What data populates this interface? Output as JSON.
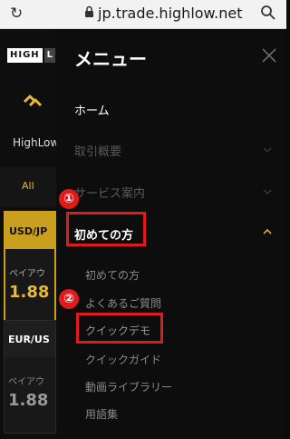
{
  "browser": {
    "url": "jp.trade.highlow.net"
  },
  "background": {
    "logo_white": "HIGH",
    "logo_dark": "L",
    "brand_text": "HighLow",
    "tab_all": "All",
    "card1": {
      "pair": "USD/JP",
      "label": "ペイアウ",
      "value": "1.88"
    },
    "card2": {
      "pair": "EUR/US",
      "label": "ペイアウ",
      "value": "1.88"
    }
  },
  "menu": {
    "title": "メニュー",
    "items": [
      {
        "label": "ホーム"
      },
      {
        "label": "取引概要"
      },
      {
        "label": "サービス案内"
      },
      {
        "label": "初めての方"
      }
    ],
    "subitems": [
      {
        "label": "初めての方"
      },
      {
        "label": "よくあるご質問"
      },
      {
        "label": "クイックデモ"
      },
      {
        "label": "クイックガイド"
      },
      {
        "label": "動画ライブラリー"
      },
      {
        "label": "用語集"
      }
    ]
  },
  "annotations": {
    "badge1": "①",
    "badge2": "②"
  },
  "colors": {
    "accent": "#e8b934",
    "highlight": "#e01b1b"
  }
}
